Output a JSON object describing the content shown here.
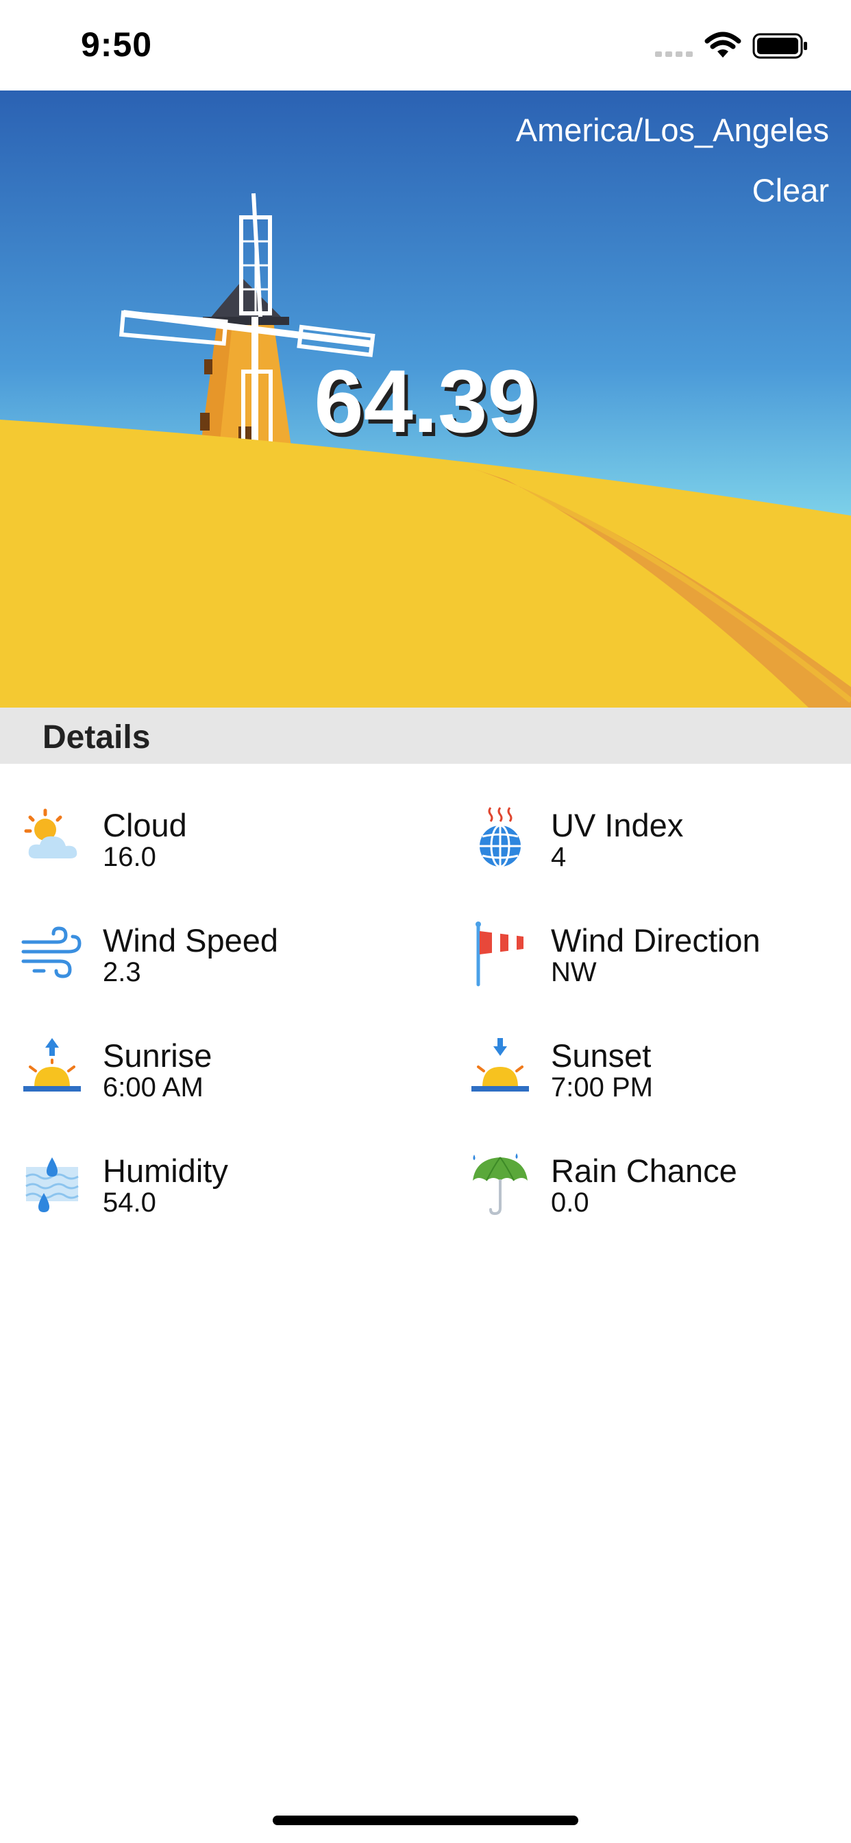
{
  "status_bar": {
    "time": "9:50"
  },
  "hero": {
    "timezone": "America/Los_Angeles",
    "condition": "Clear",
    "temperature": "64.39"
  },
  "details": {
    "title": "Details",
    "items": [
      {
        "label": "Cloud",
        "value": "16.0",
        "icon": "sun-behind-cloud-icon"
      },
      {
        "label": "UV Index",
        "value": "4",
        "icon": "globe-icon"
      },
      {
        "label": "Wind Speed",
        "value": "2.3",
        "icon": "wind-icon"
      },
      {
        "label": "Wind Direction",
        "value": "NW",
        "icon": "windsock-icon"
      },
      {
        "label": "Sunrise",
        "value": "6:00 AM",
        "icon": "sunrise-icon"
      },
      {
        "label": "Sunset",
        "value": "7:00 PM",
        "icon": "sunset-icon"
      },
      {
        "label": "Humidity",
        "value": "54.0",
        "icon": "humidity-icon"
      },
      {
        "label": "Rain Chance",
        "value": "0.0",
        "icon": "umbrella-icon"
      }
    ]
  },
  "colors": {
    "sky_top": "#2a63b4",
    "sky_bottom": "#7fd3ea",
    "field": "#f4c932",
    "path": "#e8a23a",
    "details_header_bg": "#e6e6e6"
  }
}
